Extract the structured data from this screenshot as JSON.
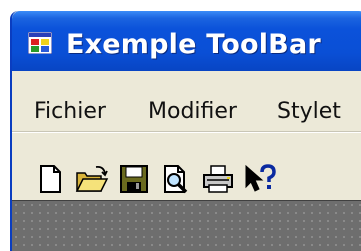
{
  "window": {
    "title": "Exemple ToolBar"
  },
  "menu": {
    "items": [
      {
        "label": "Fichier"
      },
      {
        "label": "Modifier"
      },
      {
        "label": "Stylet"
      }
    ]
  },
  "toolbar": {
    "buttons": [
      {
        "icon": "new-document-icon"
      },
      {
        "icon": "open-folder-icon"
      },
      {
        "icon": "save-icon"
      },
      {
        "icon": "print-preview-icon"
      },
      {
        "icon": "print-icon"
      },
      {
        "icon": "help-pointer-icon"
      }
    ]
  },
  "colors": {
    "titlebar": "#0a4fd6",
    "title_text": "#ffffff",
    "chrome": "#ece9d8",
    "workspace": "#6e6e6e"
  }
}
